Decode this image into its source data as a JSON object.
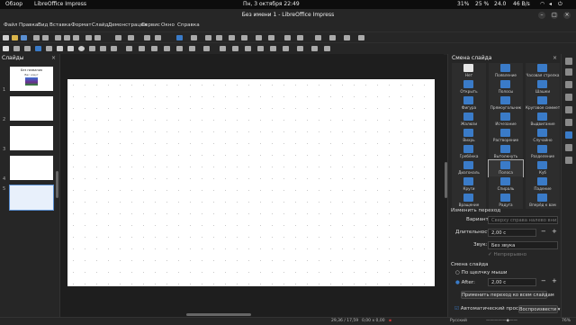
{
  "gnome": {
    "activities": "Обзор",
    "app_name": "LibreOffice Impress",
    "clock": "Пн, 3 октября  22:49",
    "battery": "31%",
    "volume": "25 %",
    "brightness": "24.0",
    "network": "46 B/s"
  },
  "window": {
    "title": "Без имени 1 - LibreOffice Impress"
  },
  "menu": [
    "Файл",
    "Правка",
    "Вид",
    "Вставка",
    "Формат",
    "Слайд",
    "Демонстрация",
    "Сервис",
    "Окно",
    "Справка"
  ],
  "slides_panel": {
    "title": "Слайды",
    "thumb1_title": "Без названия",
    "thumb1_sub": "Вас зовут",
    "numbers": [
      "1",
      "2",
      "3",
      "4",
      "5"
    ]
  },
  "sidebar": {
    "title": "Смена слайда",
    "transitions": [
      "Нет",
      "Появление",
      "Часовая стрелка",
      "Открыть",
      "Полосы",
      "Шашки",
      "Фигура",
      "Прямоугольник",
      "Круговое симметричное",
      "Жалюзи",
      "Исчезание",
      "Выдвигание",
      "Вихрь",
      "Растворение",
      "Случайно",
      "Гребёнка",
      "Вытолкнуть",
      "Разделение",
      "Диагональ",
      "Полоса",
      "Куб",
      "Круги",
      "Спираль",
      "Падение",
      "Вращение",
      "Радуга",
      "Вперёд к вам"
    ],
    "selected_index": 19,
    "modify_title": "Изменить переход",
    "variant_label": "Вариант:",
    "variant_value": "Сверху справа налево вниз",
    "duration_label": "Длительность:",
    "duration_value": "2,00 с",
    "sound_label": "Звук:",
    "sound_value": "Без звука",
    "loop_label": "Непрерывно",
    "advance_title": "Смена слайда",
    "on_click_label": "По щелчку мыши",
    "after_label": "After:",
    "after_value": "2,00 с",
    "apply_all": "Применить переход ко всем слайдам",
    "autopreview": "Автоматический просмотр",
    "play": "Воспроизвести",
    "minus": "−",
    "plus": "+"
  },
  "status": {
    "coords": "29,36 / 17,59",
    "size": "0,00 x 0,00",
    "lang": "Русский",
    "zoom": "76%"
  },
  "colors": {
    "accent": "#3a7bc8",
    "selection": "#5a8fd1"
  }
}
